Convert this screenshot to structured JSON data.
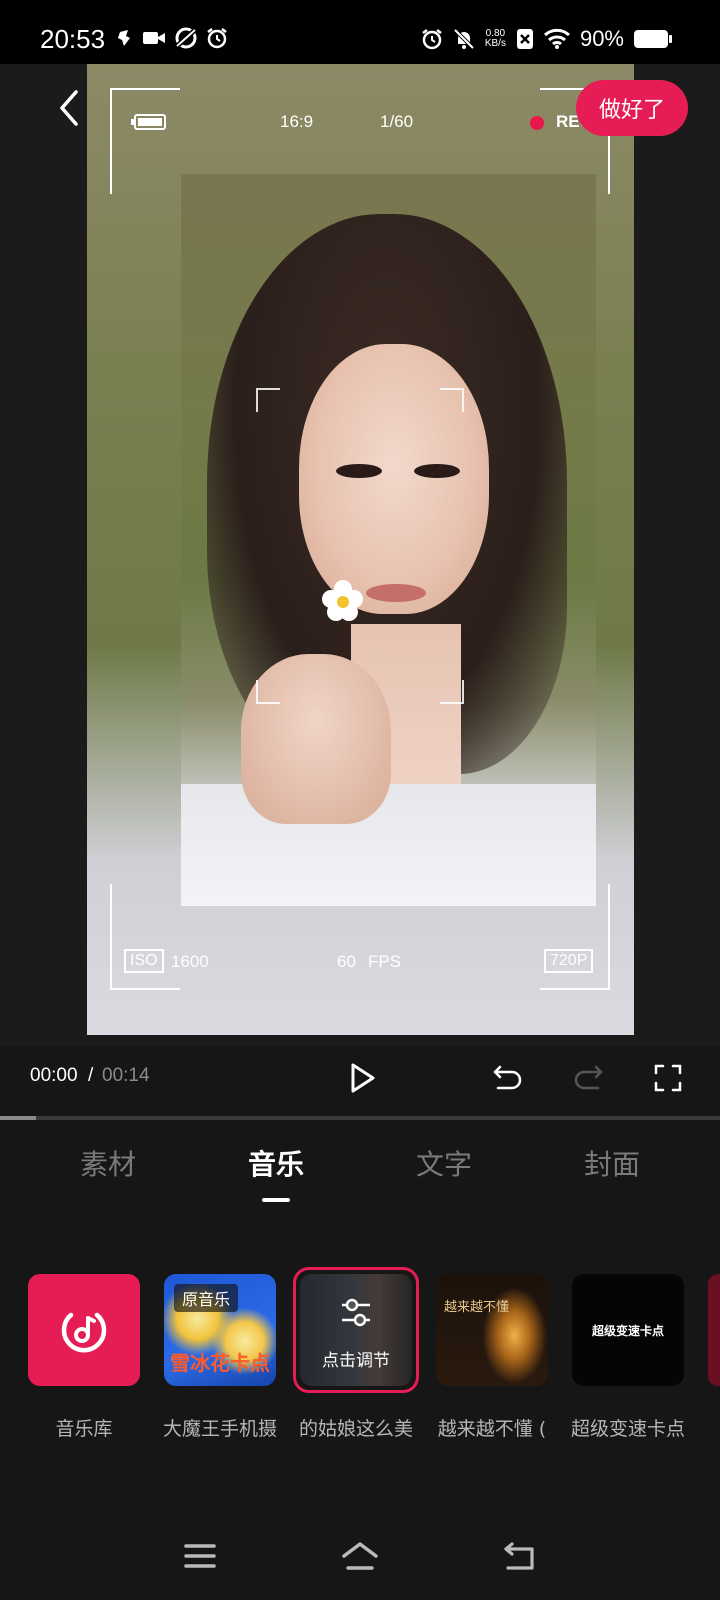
{
  "status_bar": {
    "time": "20:53",
    "net_speed_value": "0.80",
    "net_speed_unit": "KB/s",
    "battery_percent": "90%"
  },
  "overlay": {
    "aspect_ratio": "16:9",
    "frame_counter": "1/60",
    "rec_label": "REC",
    "iso_label": "ISO",
    "iso_value": "1600",
    "fps_value": "60",
    "fps_label": "FPS",
    "resolution": "720P"
  },
  "header": {
    "done_label": "做好了"
  },
  "playback": {
    "current_time": "00:00",
    "separator": "/",
    "total_time": "00:14",
    "progress": 0.05
  },
  "tabs": [
    {
      "label": "素材"
    },
    {
      "label": "音乐"
    },
    {
      "label": "文字"
    },
    {
      "label": "封面"
    }
  ],
  "active_tab": "音乐",
  "music": {
    "items": [
      {
        "label": "音乐库"
      },
      {
        "label": "大魔王手机摄",
        "tag": "原音乐",
        "thumb_text": "雪冰花卡点"
      },
      {
        "label": "的姑娘这么美",
        "overlay_text": "点击调节"
      },
      {
        "label": "越来越不懂 (",
        "thumb_text": "越来越不懂"
      },
      {
        "label": "超级变速卡点",
        "thumb_text": "超级变速卡点"
      }
    ]
  },
  "colors": {
    "accent": "#e61c55",
    "background": "#161616"
  }
}
